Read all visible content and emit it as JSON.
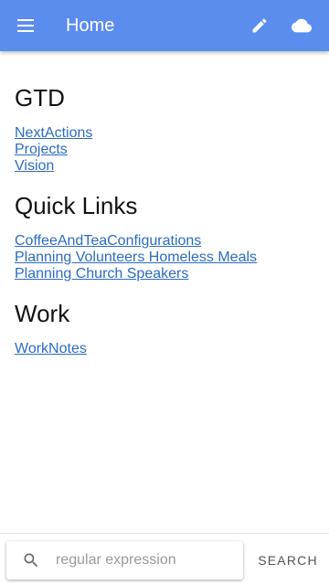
{
  "appbar": {
    "title": "Home",
    "menu_icon": "menu-icon",
    "edit_icon": "pencil-icon",
    "cloud_icon": "cloud-icon",
    "color": "#5b8def"
  },
  "sections": [
    {
      "heading": "GTD",
      "links": [
        "NextActions",
        "Projects",
        "Vision"
      ]
    },
    {
      "heading": "Quick Links",
      "links": [
        "CoffeeAndTeaConfigurations",
        "Planning Volunteers Homeless Meals",
        "Planning Church Speakers"
      ]
    },
    {
      "heading": "Work",
      "links": [
        "WorkNotes"
      ]
    }
  ],
  "search": {
    "placeholder": "regular expression",
    "value": "",
    "button_label": "SEARCH",
    "icon": "search-icon"
  }
}
